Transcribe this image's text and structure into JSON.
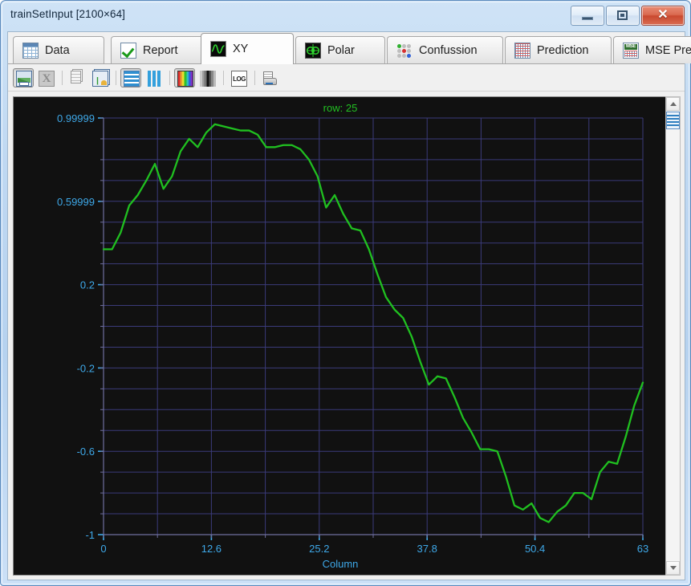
{
  "window": {
    "title": "trainSetInput [2100×64]",
    "buttons": {
      "minimize": "minimize",
      "maximize": "maximize",
      "close": "✕"
    }
  },
  "tabs": [
    {
      "label": "Data",
      "icon": "table-icon",
      "active": false
    },
    {
      "label": "Report",
      "icon": "checkmark-icon",
      "active": false
    },
    {
      "label": "XY",
      "icon": "waveform-icon",
      "active": true
    },
    {
      "label": "Polar",
      "icon": "polar-icon",
      "active": false
    },
    {
      "label": "Confussion",
      "icon": "dots-matrix-icon",
      "active": false
    },
    {
      "label": "Prediction",
      "icon": "grid-icon",
      "active": false
    },
    {
      "label": "MSE Pred",
      "icon": "mse-grid-icon",
      "active": false
    }
  ],
  "toolbar": {
    "buttons": [
      {
        "name": "save-image-button",
        "icon": "save-image-icon",
        "pressed": false
      },
      {
        "name": "export-excel-button",
        "icon": "excel-icon",
        "pressed": false
      },
      {
        "name": "copy-button",
        "icon": "copy-icon",
        "pressed": false
      },
      {
        "name": "copy-image-button",
        "icon": "copy-image-icon",
        "pressed": false
      },
      {
        "name": "rows-view-button",
        "icon": "rows-icon",
        "pressed": true
      },
      {
        "name": "columns-view-button",
        "icon": "columns-icon",
        "pressed": false
      },
      {
        "name": "color-map-button",
        "icon": "color-bars-icon",
        "pressed": true
      },
      {
        "name": "gray-map-button",
        "icon": "gray-bars-icon",
        "pressed": false
      },
      {
        "name": "log-scale-button",
        "icon": "log-icon",
        "pressed": false
      },
      {
        "name": "print-button",
        "icon": "printer-icon",
        "pressed": false
      }
    ],
    "log_label": "LOG"
  },
  "scrollbar": {
    "up_label": "▲",
    "down_label": "▼",
    "thumb_label": "rows-thumb"
  },
  "chart_data": {
    "type": "line",
    "title": "row: 25",
    "xlabel": "Column",
    "ylabel": "",
    "xlim": [
      0,
      63
    ],
    "ylim": [
      -1,
      0.99999
    ],
    "xticks": [
      "0",
      "12.6",
      "25.2",
      "37.8",
      "50.4",
      "63"
    ],
    "xtick_values": [
      0,
      12.6,
      25.2,
      37.8,
      50.4,
      63
    ],
    "yticks": [
      "0.99999",
      "0.59999",
      "0.2",
      "-0.2",
      "-0.6",
      "-1"
    ],
    "ytick_values": [
      0.99999,
      0.59999,
      0.2,
      -0.2,
      -0.6,
      -1
    ],
    "grid": true,
    "grid_color": "#3b3b7a",
    "background": "#111111",
    "line_color": "#20c020",
    "tick_label_color": "#3ea8e8",
    "title_color": "#22c022",
    "legend": null,
    "series": [
      {
        "name": "row 25",
        "x": [
          0,
          1,
          2,
          3,
          4,
          5,
          6,
          7,
          8,
          9,
          10,
          11,
          12,
          13,
          14,
          15,
          16,
          17,
          18,
          19,
          20,
          21,
          22,
          23,
          24,
          25,
          26,
          27,
          28,
          29,
          30,
          31,
          32,
          33,
          34,
          35,
          36,
          37,
          38,
          39,
          40,
          41,
          42,
          43,
          44,
          45,
          46,
          47,
          48,
          49,
          50,
          51,
          52,
          53,
          54,
          55,
          56,
          57,
          58,
          59,
          60,
          61,
          62,
          63
        ],
        "values": [
          0.37,
          0.37,
          0.45,
          0.58,
          0.63,
          0.7,
          0.78,
          0.66,
          0.72,
          0.84,
          0.9,
          0.86,
          0.93,
          0.97,
          0.96,
          0.95,
          0.94,
          0.94,
          0.92,
          0.86,
          0.86,
          0.87,
          0.87,
          0.85,
          0.8,
          0.72,
          0.57,
          0.63,
          0.54,
          0.47,
          0.46,
          0.37,
          0.25,
          0.14,
          0.08,
          0.04,
          -0.05,
          -0.17,
          -0.28,
          -0.24,
          -0.25,
          -0.34,
          -0.44,
          -0.51,
          -0.59,
          -0.59,
          -0.6,
          -0.72,
          -0.86,
          -0.88,
          -0.85,
          -0.92,
          -0.94,
          -0.89,
          -0.86,
          -0.8,
          -0.8,
          -0.83,
          -0.7,
          -0.65,
          -0.66,
          -0.53,
          -0.38,
          -0.27
        ]
      }
    ]
  }
}
